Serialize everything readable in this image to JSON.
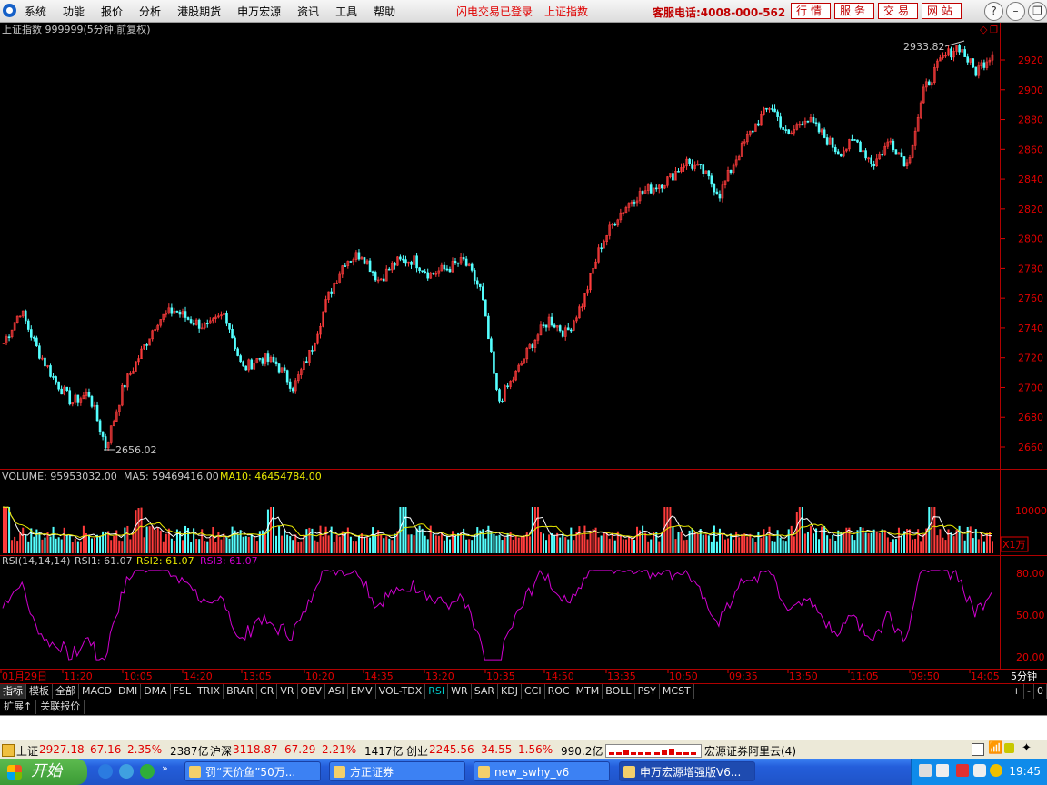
{
  "menu": [
    "系统",
    "功能",
    "报价",
    "分析",
    "港股期货",
    "申万宏源",
    "资讯",
    "工具",
    "帮助"
  ],
  "login_status": "闪电交易已登录",
  "index_name": "上证指数",
  "hotline": "客服电话:4008-000-562",
  "top_buttons": [
    "行情",
    "服务",
    "交易",
    "网站"
  ],
  "chart_title": "上证指数 999999(5分钟,前复权)",
  "price_axis": [
    "2920",
    "2900",
    "2880",
    "2860",
    "2840",
    "2820",
    "2800",
    "2780",
    "2760",
    "2740",
    "2720",
    "2700",
    "2680",
    "2660"
  ],
  "high_label": "2933.82",
  "low_label": "2656.02",
  "volume": {
    "label": "VOLUME: 95953032.00",
    "ma5": "MA5: 59469416.00",
    "ma10": "MA10: 46454784.00",
    "axis_value": "10000",
    "unit": "X1万"
  },
  "rsi": {
    "label": "RSI(14,14,14)",
    "rsi1": "RSI1: 61.07",
    "rsi2": "RSI2: 61.07",
    "rsi3": "RSI3: 61.07",
    "axis": [
      "80.00",
      "50.00",
      "20.00"
    ]
  },
  "time_axis": [
    "01月29日",
    "11:20",
    "10:05",
    "14:20",
    "13:05",
    "10:20",
    "14:35",
    "13:20",
    "10:35",
    "14:50",
    "13:35",
    "10:50",
    "09:35",
    "13:50",
    "11:05",
    "09:50",
    "14:05"
  ],
  "period_label": "5分钟",
  "tabs": [
    "指标",
    "模板",
    "全部",
    "MACD",
    "DMI",
    "DMA",
    "FSL",
    "TRIX",
    "BRAR",
    "CR",
    "VR",
    "OBV",
    "ASI",
    "EMV",
    "VOL-TDX",
    "RSI",
    "WR",
    "SAR",
    "KDJ",
    "CCI",
    "ROC",
    "MTM",
    "BOLL",
    "PSY",
    "MCST"
  ],
  "tab_right": [
    "+",
    "-",
    "0"
  ],
  "subtabs": [
    "扩展↑",
    "关联报价"
  ],
  "status": {
    "sh_label": "上证",
    "sh_value": "2927.18",
    "sh_change": "67.16",
    "sh_pct": "2.35%",
    "sh_amount": "2387亿",
    "hs_label": "沪深",
    "hs_value": "3118.87",
    "hs_change": "67.29",
    "hs_pct": "2.21%",
    "hs_amount": "1417亿",
    "cy_label": "创业",
    "cy_value": "2245.56",
    "cy_change": "34.55",
    "cy_pct": "1.56%",
    "cy_amount": "990.2亿",
    "broker": "宏源证券阿里云(4)"
  },
  "taskbar": {
    "start": "开始",
    "items": [
      "罚“天价鱼”50万...",
      "方正证券",
      "new_swhy_v6",
      "申万宏源增强版V6..."
    ],
    "clock": "19:45"
  },
  "chart_data": {
    "type": "candlestick",
    "title": "上证指数 999999(5分钟,前复权)",
    "period": "5分钟",
    "price_axis_range": [
      2650,
      2935
    ],
    "close_path_approx": [
      2730,
      2752,
      2725,
      2705,
      2690,
      2696,
      2660,
      2700,
      2722,
      2745,
      2752,
      2745,
      2740,
      2750,
      2712,
      2720,
      2716,
      2700,
      2724,
      2760,
      2785,
      2790,
      2772,
      2784,
      2786,
      2776,
      2780,
      2785,
      2765,
      2690,
      2708,
      2730,
      2746,
      2736,
      2758,
      2795,
      2815,
      2828,
      2834,
      2840,
      2852,
      2845,
      2830,
      2855,
      2875,
      2890,
      2868,
      2882,
      2870,
      2858,
      2866,
      2850,
      2866,
      2850,
      2900,
      2920,
      2930,
      2912,
      2925
    ],
    "high": 2933.82,
    "low": 2656.02,
    "volume_ma": {
      "ma5": 59469416.0,
      "ma10": 46454784.0,
      "last": 95953032.0
    },
    "rsi_last": 61.07,
    "rsi_range": [
      20,
      80
    ]
  }
}
